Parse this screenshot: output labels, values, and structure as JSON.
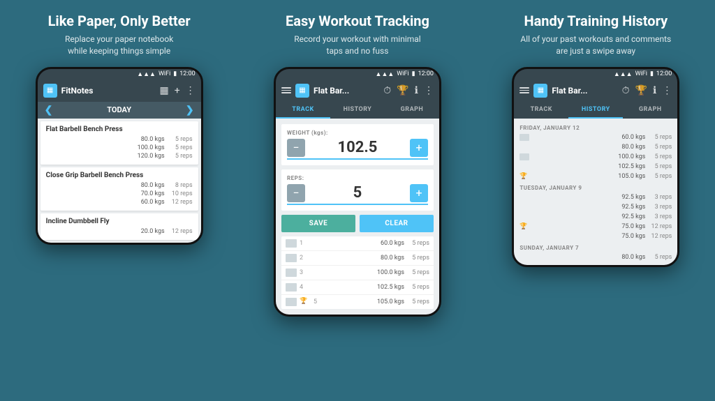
{
  "panels": [
    {
      "id": "panel1",
      "title": "Like Paper, Only Better",
      "subtitle": "Replace your paper notebook\nwhile keeping things simple",
      "phone": {
        "statusBar": {
          "time": "12:00"
        },
        "toolbar": {
          "appName": "FitNotes",
          "icons": [
            "▦",
            "+",
            "⋮"
          ]
        },
        "dateNav": {
          "label": "TODAY",
          "prevArrow": "❮",
          "nextArrow": "❯"
        },
        "exercises": [
          {
            "name": "Flat Barbell Bench Press",
            "sets": [
              {
                "weight": "80.0 kgs",
                "reps": "5 reps"
              },
              {
                "weight": "100.0 kgs",
                "reps": "5 reps"
              },
              {
                "weight": "120.0 kgs",
                "reps": "5 reps"
              }
            ]
          },
          {
            "name": "Close Grip Barbell Bench Press",
            "sets": [
              {
                "weight": "80.0 kgs",
                "reps": "8 reps"
              },
              {
                "weight": "70.0 kgs",
                "reps": "10 reps"
              },
              {
                "weight": "60.0 kgs",
                "reps": "12 reps"
              }
            ]
          },
          {
            "name": "Incline Dumbbell Fly",
            "sets": [
              {
                "weight": "20.0 kgs",
                "reps": "12 reps"
              }
            ]
          }
        ]
      }
    },
    {
      "id": "panel2",
      "title": "Easy Workout Tracking",
      "subtitle": "Record your workout with minimal\ntaps and no fuss",
      "phone": {
        "statusBar": {
          "time": "12:00"
        },
        "toolbar": {
          "appName": "Flat Bar...",
          "icons": [
            "⏱",
            "🏆",
            "ℹ",
            "⋮"
          ]
        },
        "tabs": [
          {
            "label": "TRACK",
            "active": true
          },
          {
            "label": "HISTORY",
            "active": false
          },
          {
            "label": "GRAPH",
            "active": false
          }
        ],
        "weightLabel": "WEIGHT (kgs):",
        "weightValue": "102.5",
        "repsLabel": "REPS:",
        "repsValue": "5",
        "saveLabel": "SAVE",
        "clearLabel": "CLEAR",
        "sets": [
          {
            "num": "1",
            "weight": "60.0 kgs",
            "reps": "5 reps",
            "icon": "comment",
            "trophy": false
          },
          {
            "num": "2",
            "weight": "80.0 kgs",
            "reps": "5 reps",
            "icon": "comment",
            "trophy": false
          },
          {
            "num": "3",
            "weight": "100.0 kgs",
            "reps": "5 reps",
            "icon": "comment",
            "trophy": false
          },
          {
            "num": "4",
            "weight": "102.5 kgs",
            "reps": "5 reps",
            "icon": "comment",
            "trophy": false
          },
          {
            "num": "5",
            "weight": "105.0 kgs",
            "reps": "5 reps",
            "icon": "trophy",
            "trophy": true
          }
        ]
      }
    },
    {
      "id": "panel3",
      "title": "Handy Training History",
      "subtitle": "All of your past workouts and comments\nare just a swipe away",
      "phone": {
        "statusBar": {
          "time": "12:00"
        },
        "toolbar": {
          "appName": "Flat Bar...",
          "icons": [
            "⏱",
            "🏆",
            "ℹ",
            "⋮"
          ]
        },
        "tabs": [
          {
            "label": "TRACK",
            "active": false
          },
          {
            "label": "HISTORY",
            "active": true
          },
          {
            "label": "GRAPH",
            "active": false
          }
        ],
        "historyGroups": [
          {
            "date": "FRIDAY, JANUARY 12",
            "rows": [
              {
                "weight": "60.0 kgs",
                "reps": "5 reps",
                "icon": "comment",
                "trophy": false
              },
              {
                "weight": "80.0 kgs",
                "reps": "5 reps",
                "icon": "none",
                "trophy": false
              },
              {
                "weight": "100.0 kgs",
                "reps": "5 reps",
                "icon": "comment",
                "trophy": false
              },
              {
                "weight": "102.5 kgs",
                "reps": "5 reps",
                "icon": "none",
                "trophy": false
              },
              {
                "weight": "105.0 kgs",
                "reps": "5 reps",
                "icon": "trophy",
                "trophy": true
              }
            ]
          },
          {
            "date": "TUESDAY, JANUARY 9",
            "rows": [
              {
                "weight": "92.5 kgs",
                "reps": "3 reps",
                "icon": "none",
                "trophy": false
              },
              {
                "weight": "92.5 kgs",
                "reps": "3 reps",
                "icon": "none",
                "trophy": false
              },
              {
                "weight": "92.5 kgs",
                "reps": "3 reps",
                "icon": "none",
                "trophy": false
              },
              {
                "weight": "75.0 kgs",
                "reps": "12 reps",
                "icon": "trophy",
                "trophy": true
              },
              {
                "weight": "75.0 kgs",
                "reps": "12 reps",
                "icon": "none",
                "trophy": false
              }
            ]
          },
          {
            "date": "SUNDAY, JANUARY 7",
            "rows": [
              {
                "weight": "80.0 kgs",
                "reps": "5 reps",
                "icon": "none",
                "trophy": false
              }
            ]
          }
        ]
      }
    }
  ]
}
